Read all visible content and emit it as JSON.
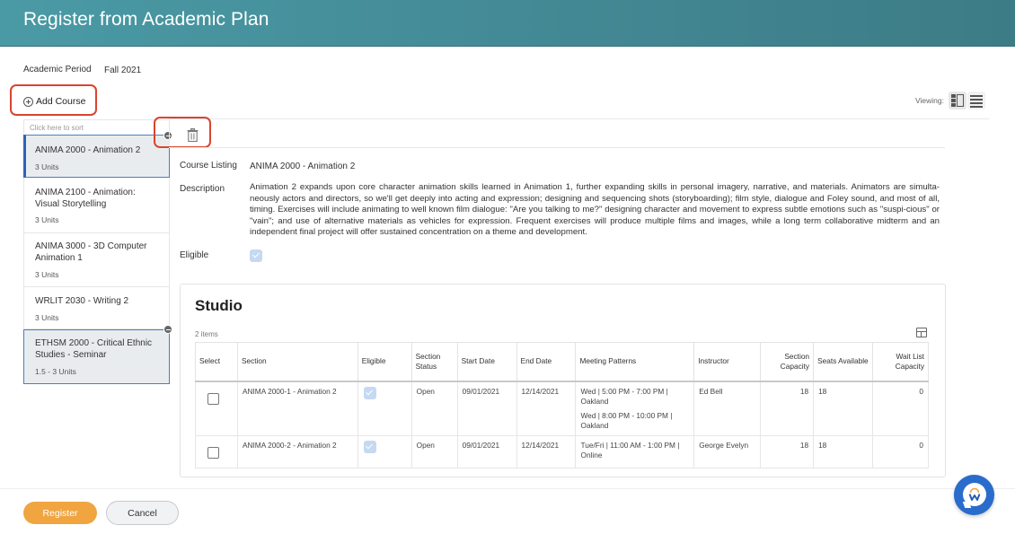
{
  "header": {
    "title": "Register from Academic Plan"
  },
  "academic_period": {
    "label": "Academic Period",
    "value": "Fall 2021"
  },
  "toolbar": {
    "add_course_label": "Add Course",
    "viewing_label": "Viewing:",
    "view_modes": [
      "split-view",
      "list-view"
    ],
    "active_view": "split-view"
  },
  "course_list": {
    "sort_hint": "Click here to sort",
    "items": [
      {
        "title": "ANIMA 2000 - Animation 2",
        "units": "3 Units",
        "selected": true
      },
      {
        "title": "ANIMA 2100 - Animation: Visual Storytelling",
        "units": "3 Units",
        "selected": false
      },
      {
        "title": "ANIMA 3000 - 3D Computer Animation 1",
        "units": "3 Units",
        "selected": false
      },
      {
        "title": "WRLIT 2030 - Writing 2",
        "units": "3 Units",
        "selected": false
      },
      {
        "title": "ETHSM 2000 - Critical Ethnic Studies - Seminar",
        "units": "1.5 - 3 Units",
        "selected": true
      }
    ]
  },
  "detail": {
    "course_listing_label": "Course Listing",
    "course_listing_value": "ANIMA 2000 - Animation 2",
    "description_label": "Description",
    "description": "Animation 2 expands upon core character animation skills learned in Animation 1, further expanding skills in personal imagery, narrative, and materials. Animators are simulta-neously actors and directors, so we'll get deeply into acting and expression; designing and sequencing shots (storyboarding); film style, dialogue and Foley sound, and most of all, timing. Exercises will include animating to well known film dialogue: \"Are you talking to me?\" designing character and movement to express subtle emotions such as \"suspi-cious\" or \"vain\"; and use of alternative materials as vehicles for expression. Frequent exercises will produce multiple films and images, while a long term collaborative midterm and an independent final project will offer sustained concentration on a theme and development.",
    "eligible_label": "Eligible",
    "eligible": true
  },
  "studio": {
    "title": "Studio",
    "items_count": "2 items",
    "columns": [
      "Select",
      "Section",
      "Eligible",
      "Section Status",
      "Start Date",
      "End Date",
      "Meeting Patterns",
      "Instructor",
      "Section Capacity",
      "Seats Available",
      "Wait List Capacity"
    ],
    "rows": [
      {
        "selected": false,
        "section": "ANIMA 2000-1 - Animation 2",
        "eligible": true,
        "status": "Open",
        "start_date": "09/01/2021",
        "end_date": "12/14/2021",
        "meeting_patterns": [
          "Wed | 5:00 PM - 7:00 PM | Oakland",
          "Wed | 8:00 PM - 10:00 PM | Oakland"
        ],
        "instructor": "Ed Bell",
        "section_capacity": "18",
        "seats_available": "18",
        "wait_list_capacity": "0"
      },
      {
        "selected": false,
        "section": "ANIMA 2000-2 - Animation 2",
        "eligible": true,
        "status": "Open",
        "start_date": "09/01/2021",
        "end_date": "12/14/2021",
        "meeting_patterns": [
          "Tue/Fri | 11:00 AM - 1:00 PM | Online"
        ],
        "instructor": "George Evelyn",
        "section_capacity": "18",
        "seats_available": "18",
        "wait_list_capacity": "0"
      }
    ]
  },
  "footer": {
    "register_label": "Register",
    "cancel_label": "Cancel"
  },
  "colors": {
    "header": "#438a96",
    "primary_button": "#f0a541",
    "selection": "#2e62b7",
    "highlight_annotation": "#d9452e",
    "chat_fab": "#2a6ccb"
  }
}
